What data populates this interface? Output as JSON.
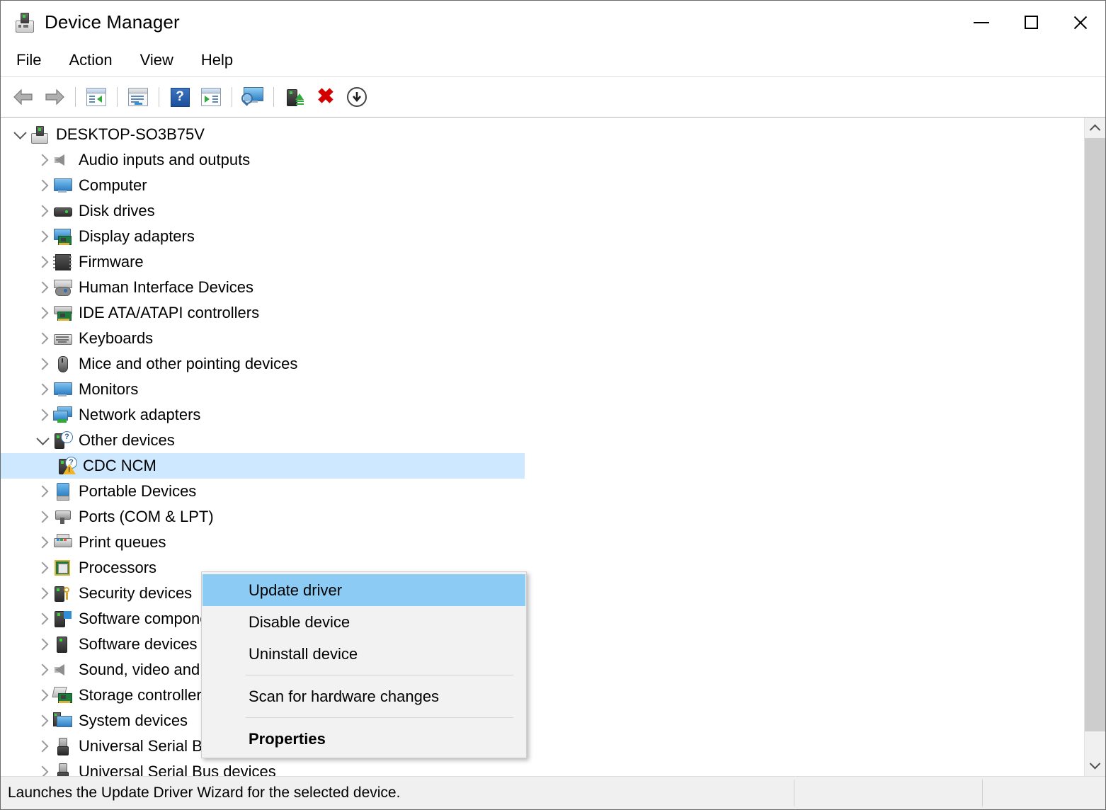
{
  "window": {
    "title": "Device Manager",
    "icon": "device-manager-icon",
    "controls": {
      "minimize": "minimize-icon",
      "maximize": "maximize-icon",
      "close": "close-icon"
    }
  },
  "menubar": {
    "items": [
      {
        "label": "File"
      },
      {
        "label": "Action"
      },
      {
        "label": "View"
      },
      {
        "label": "Help"
      }
    ]
  },
  "toolbar": {
    "buttons": [
      {
        "name": "back-icon",
        "tooltip": "Back"
      },
      {
        "name": "forward-icon",
        "tooltip": "Forward"
      },
      {
        "name": "show-hide-console-tree-icon",
        "tooltip": "Show/Hide Console Tree"
      },
      {
        "name": "properties-icon",
        "tooltip": "Properties"
      },
      {
        "name": "help-icon",
        "tooltip": "Help"
      },
      {
        "name": "update-driver-icon",
        "tooltip": "Update driver"
      },
      {
        "name": "scan-for-hardware-changes-icon",
        "tooltip": "Scan for hardware changes"
      },
      {
        "name": "enable-device-icon",
        "tooltip": "Enable device"
      },
      {
        "name": "uninstall-device-icon",
        "tooltip": "Uninstall device"
      },
      {
        "name": "disable-device-icon",
        "tooltip": "Disable device"
      }
    ]
  },
  "tree": {
    "root": {
      "label": "DESKTOP-SO3B75V",
      "icon": "computer-icon",
      "expanded": true
    },
    "nodes": [
      {
        "label": "Audio inputs and outputs",
        "icon": "speaker-icon",
        "expanded": false
      },
      {
        "label": "Computer",
        "icon": "monitor-icon",
        "expanded": false
      },
      {
        "label": "Disk drives",
        "icon": "disk-icon",
        "expanded": false
      },
      {
        "label": "Display adapters",
        "icon": "display-adapter-icon",
        "expanded": false
      },
      {
        "label": "Firmware",
        "icon": "firmware-chip-icon",
        "expanded": false
      },
      {
        "label": "Human Interface Devices",
        "icon": "gamepad-keyboard-icon",
        "expanded": false
      },
      {
        "label": "IDE ATA/ATAPI controllers",
        "icon": "ide-controller-icon",
        "expanded": false
      },
      {
        "label": "Keyboards",
        "icon": "keyboard-icon",
        "expanded": false
      },
      {
        "label": "Mice and other pointing devices",
        "icon": "mouse-icon",
        "expanded": false
      },
      {
        "label": "Monitors",
        "icon": "monitor-icon",
        "expanded": false
      },
      {
        "label": "Network adapters",
        "icon": "network-adapter-icon",
        "expanded": false
      },
      {
        "label": "Other devices",
        "icon": "unknown-device-icon",
        "expanded": true
      },
      {
        "label": "CDC NCM",
        "icon": "unknown-device-warning-icon",
        "child": true,
        "selected": true
      },
      {
        "label": "Portable Devices",
        "icon": "portable-device-icon",
        "expanded": false
      },
      {
        "label": "Ports (COM & LPT)",
        "icon": "port-icon",
        "expanded": false
      },
      {
        "label": "Print queues",
        "icon": "printer-icon",
        "expanded": false
      },
      {
        "label": "Processors",
        "icon": "processor-icon",
        "expanded": false
      },
      {
        "label": "Security devices",
        "icon": "security-device-icon",
        "expanded": false
      },
      {
        "label": "Software components",
        "icon": "software-component-icon",
        "expanded": false
      },
      {
        "label": "Software devices",
        "icon": "software-device-icon",
        "expanded": false
      },
      {
        "label": "Sound, video and game controllers",
        "icon": "speaker-icon",
        "expanded": false
      },
      {
        "label": "Storage controllers",
        "icon": "storage-controller-icon",
        "expanded": false
      },
      {
        "label": "System devices",
        "icon": "system-device-icon",
        "expanded": false
      },
      {
        "label": "Universal Serial Bus controllers",
        "icon": "usb-icon",
        "expanded": false
      },
      {
        "label": "Universal Serial Bus devices",
        "icon": "usb-icon",
        "expanded": false
      }
    ]
  },
  "context_menu": {
    "target": "CDC NCM",
    "items": [
      {
        "label": "Update driver",
        "highlighted": true,
        "bold": false,
        "separator_after": false
      },
      {
        "label": "Disable device",
        "highlighted": false,
        "bold": false,
        "separator_after": false
      },
      {
        "label": "Uninstall device",
        "highlighted": false,
        "bold": false,
        "separator_after": true
      },
      {
        "label": "Scan for hardware changes",
        "highlighted": false,
        "bold": false,
        "separator_after": true
      },
      {
        "label": "Properties",
        "highlighted": false,
        "bold": true,
        "separator_after": false
      }
    ]
  },
  "statusbar": {
    "message": "Launches the Update Driver Wizard for the selected device.",
    "panel2": "",
    "panel3": ""
  },
  "colors": {
    "selection": "#cde8ff",
    "menu_highlight": "#8ccbf4",
    "window_border": "#6b6b6b",
    "status_bg": "#f0f0f0",
    "scrollbar_thumb": "#cdcdcd"
  },
  "scrollbar": {
    "up": "chevron-up-icon",
    "down": "chevron-down-icon"
  }
}
